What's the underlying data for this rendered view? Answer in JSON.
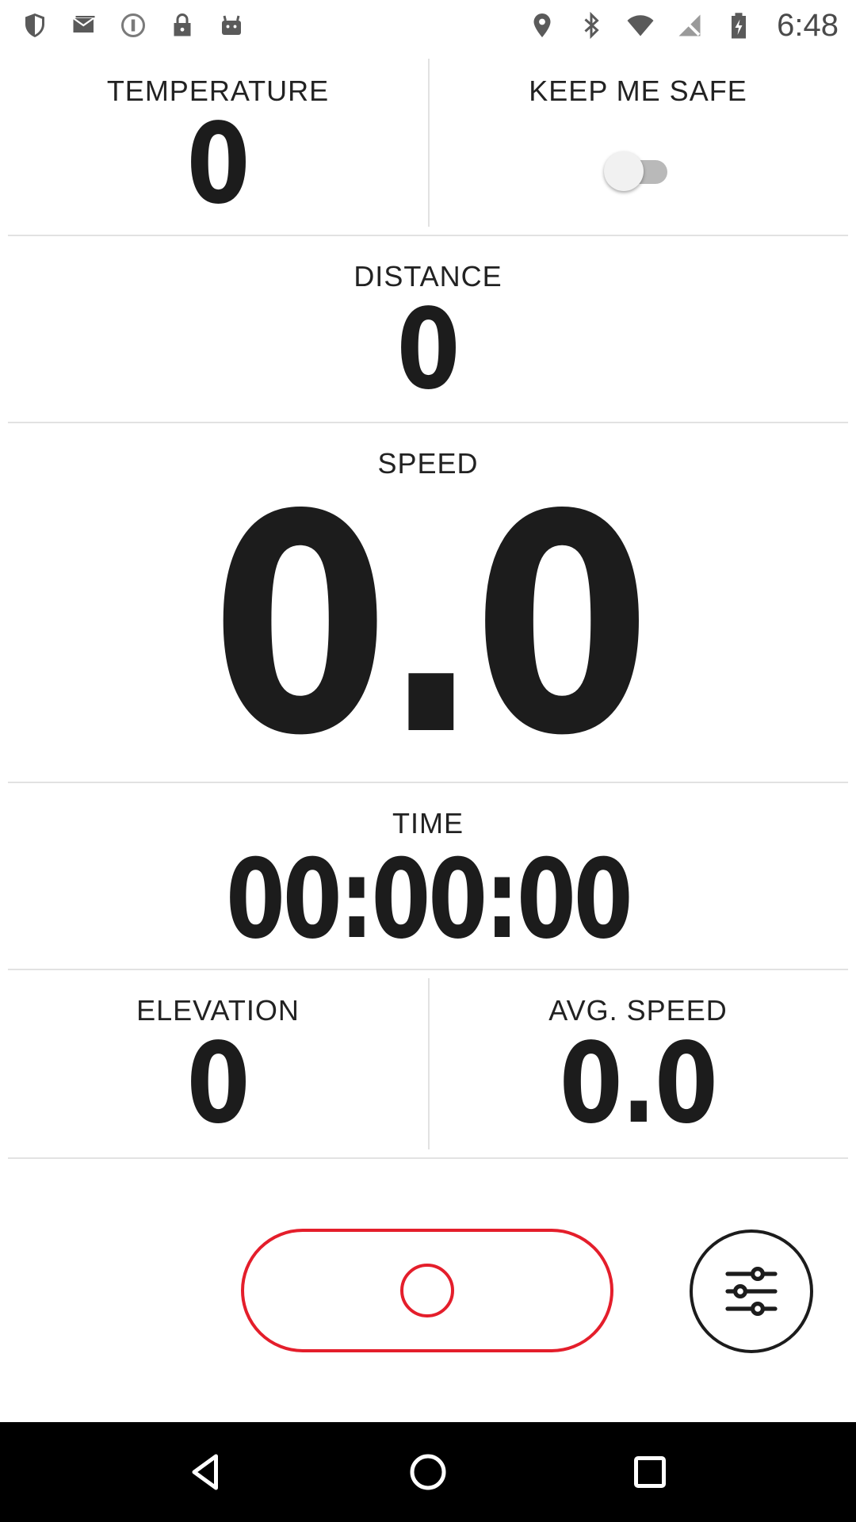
{
  "status_bar": {
    "time": "6:48",
    "left_icons": [
      "shield-icon",
      "mail-icon",
      "info-icon",
      "lock-icon",
      "android-icon"
    ],
    "right_icons": [
      "location-icon",
      "bluetooth-icon",
      "wifi-icon",
      "no-signal-icon",
      "battery-icon"
    ]
  },
  "stats": {
    "temperature": {
      "label": "TEMPERATURE",
      "value": "0"
    },
    "keep_me_safe": {
      "label": "KEEP ME SAFE",
      "enabled": false
    },
    "distance": {
      "label": "DISTANCE",
      "value": "0"
    },
    "speed": {
      "label": "SPEED",
      "value": "0.0"
    },
    "time": {
      "label": "TIME",
      "value": "00:00:00"
    },
    "elevation": {
      "label": "ELEVATION",
      "value": "0"
    },
    "avg_speed": {
      "label": "AVG. SPEED",
      "value": "0.0"
    }
  },
  "controls": {
    "record_icon": "record-icon",
    "settings_icon": "sliders-icon"
  },
  "colors": {
    "accent": "#e41e2b",
    "text": "#1c1c1c",
    "divider": "#e2e2e2"
  },
  "nav_bar": {
    "icons": [
      "back-icon",
      "home-icon",
      "recents-icon"
    ]
  }
}
